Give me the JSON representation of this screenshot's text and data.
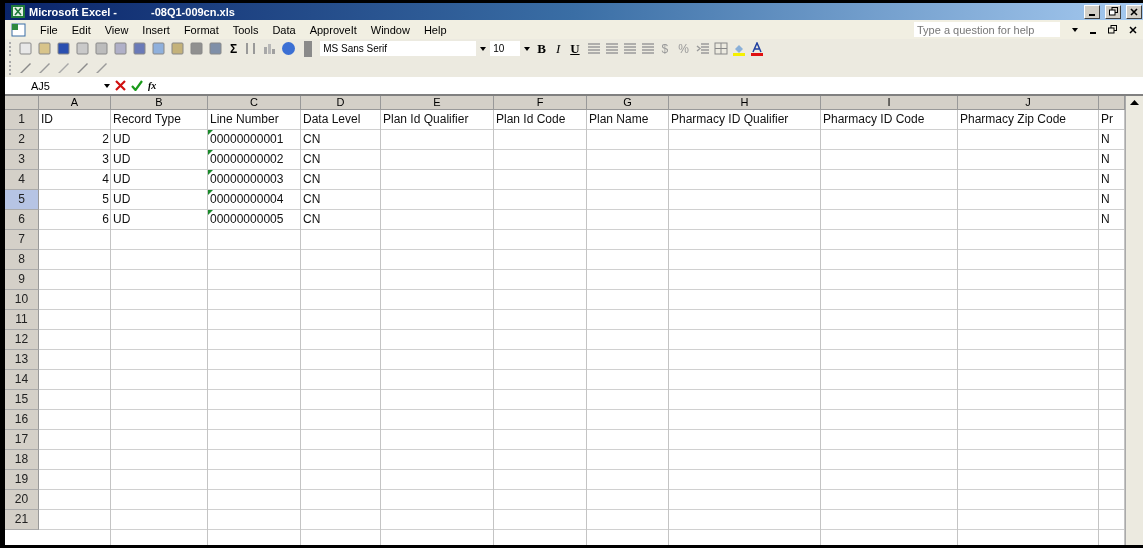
{
  "window": {
    "title_app": "Microsoft Excel -",
    "title_file": "-08Q1-009cn.xls"
  },
  "menu": [
    "File",
    "Edit",
    "View",
    "Insert",
    "Format",
    "Tools",
    "Data",
    "ApproveIt",
    "Window",
    "Help"
  ],
  "help_box": {
    "placeholder": "Type a question for help"
  },
  "toolbar": {
    "sum": "Σ",
    "font": "MS Sans Serif",
    "size": "10",
    "bold": "B",
    "italic": "I",
    "underline": "U",
    "currency": "$",
    "percent": "%"
  },
  "formula_bar": {
    "name_box": "AJ5",
    "function_label": "fx"
  },
  "sheet": {
    "columns": [
      "A",
      "B",
      "C",
      "D",
      "E",
      "F",
      "G",
      "H",
      "I",
      "J"
    ],
    "rows": [
      {
        "number": "1",
        "selected": false,
        "cells": [
          {
            "text": "ID",
            "kind": "text",
            "flag": false
          },
          {
            "text": "Record Type",
            "kind": "text",
            "flag": false
          },
          {
            "text": "Line Number",
            "kind": "text",
            "flag": false
          },
          {
            "text": "Data Level",
            "kind": "text",
            "flag": false
          },
          {
            "text": "Plan Id Qualifier",
            "kind": "text",
            "flag": false
          },
          {
            "text": "Plan Id Code",
            "kind": "text",
            "flag": false
          },
          {
            "text": "Plan Name",
            "kind": "text",
            "flag": false
          },
          {
            "text": "Pharmacy ID Qualifier",
            "kind": "text",
            "flag": false
          },
          {
            "text": "Pharmacy ID Code",
            "kind": "text",
            "flag": false
          },
          {
            "text": "Pharmacy Zip Code",
            "kind": "text",
            "flag": false
          }
        ],
        "edge_cell": "Pr"
      },
      {
        "number": "2",
        "selected": false,
        "cells": [
          {
            "text": "2",
            "kind": "number",
            "flag": false
          },
          {
            "text": "UD",
            "kind": "text",
            "flag": false
          },
          {
            "text": "00000000001",
            "kind": "text",
            "flag": true
          },
          {
            "text": "CN",
            "kind": "text",
            "flag": false
          }
        ],
        "edge_cell": "N"
      },
      {
        "number": "3",
        "selected": false,
        "cells": [
          {
            "text": "3",
            "kind": "number",
            "flag": false
          },
          {
            "text": "UD",
            "kind": "text",
            "flag": false
          },
          {
            "text": "00000000002",
            "kind": "text",
            "flag": true
          },
          {
            "text": "CN",
            "kind": "text",
            "flag": false
          }
        ],
        "edge_cell": "N"
      },
      {
        "number": "4",
        "selected": false,
        "cells": [
          {
            "text": "4",
            "kind": "number",
            "flag": false
          },
          {
            "text": "UD",
            "kind": "text",
            "flag": false
          },
          {
            "text": "00000000003",
            "kind": "text",
            "flag": true
          },
          {
            "text": "CN",
            "kind": "text",
            "flag": false
          }
        ],
        "edge_cell": "N"
      },
      {
        "number": "5",
        "selected": true,
        "cells": [
          {
            "text": "5",
            "kind": "number",
            "flag": false
          },
          {
            "text": "UD",
            "kind": "text",
            "flag": false
          },
          {
            "text": "00000000004",
            "kind": "text",
            "flag": true
          },
          {
            "text": "CN",
            "kind": "text",
            "flag": false
          }
        ],
        "edge_cell": "N"
      },
      {
        "number": "6",
        "selected": false,
        "cells": [
          {
            "text": "6",
            "kind": "number",
            "flag": false
          },
          {
            "text": "UD",
            "kind": "text",
            "flag": false
          },
          {
            "text": "00000000005",
            "kind": "text",
            "flag": true
          },
          {
            "text": "CN",
            "kind": "text",
            "flag": false
          }
        ],
        "edge_cell": "N"
      },
      {
        "number": "7",
        "selected": false
      },
      {
        "number": "8",
        "selected": false
      },
      {
        "number": "9",
        "selected": false
      },
      {
        "number": "10",
        "selected": false
      },
      {
        "number": "11",
        "selected": false
      },
      {
        "number": "12",
        "selected": false
      },
      {
        "number": "13",
        "selected": false
      },
      {
        "number": "14",
        "selected": false
      },
      {
        "number": "15",
        "selected": false
      },
      {
        "number": "16",
        "selected": false
      },
      {
        "number": "17",
        "selected": false
      },
      {
        "number": "18",
        "selected": false
      },
      {
        "number": "19",
        "selected": false
      },
      {
        "number": "20",
        "selected": false
      },
      {
        "number": "21",
        "selected": false
      }
    ]
  }
}
